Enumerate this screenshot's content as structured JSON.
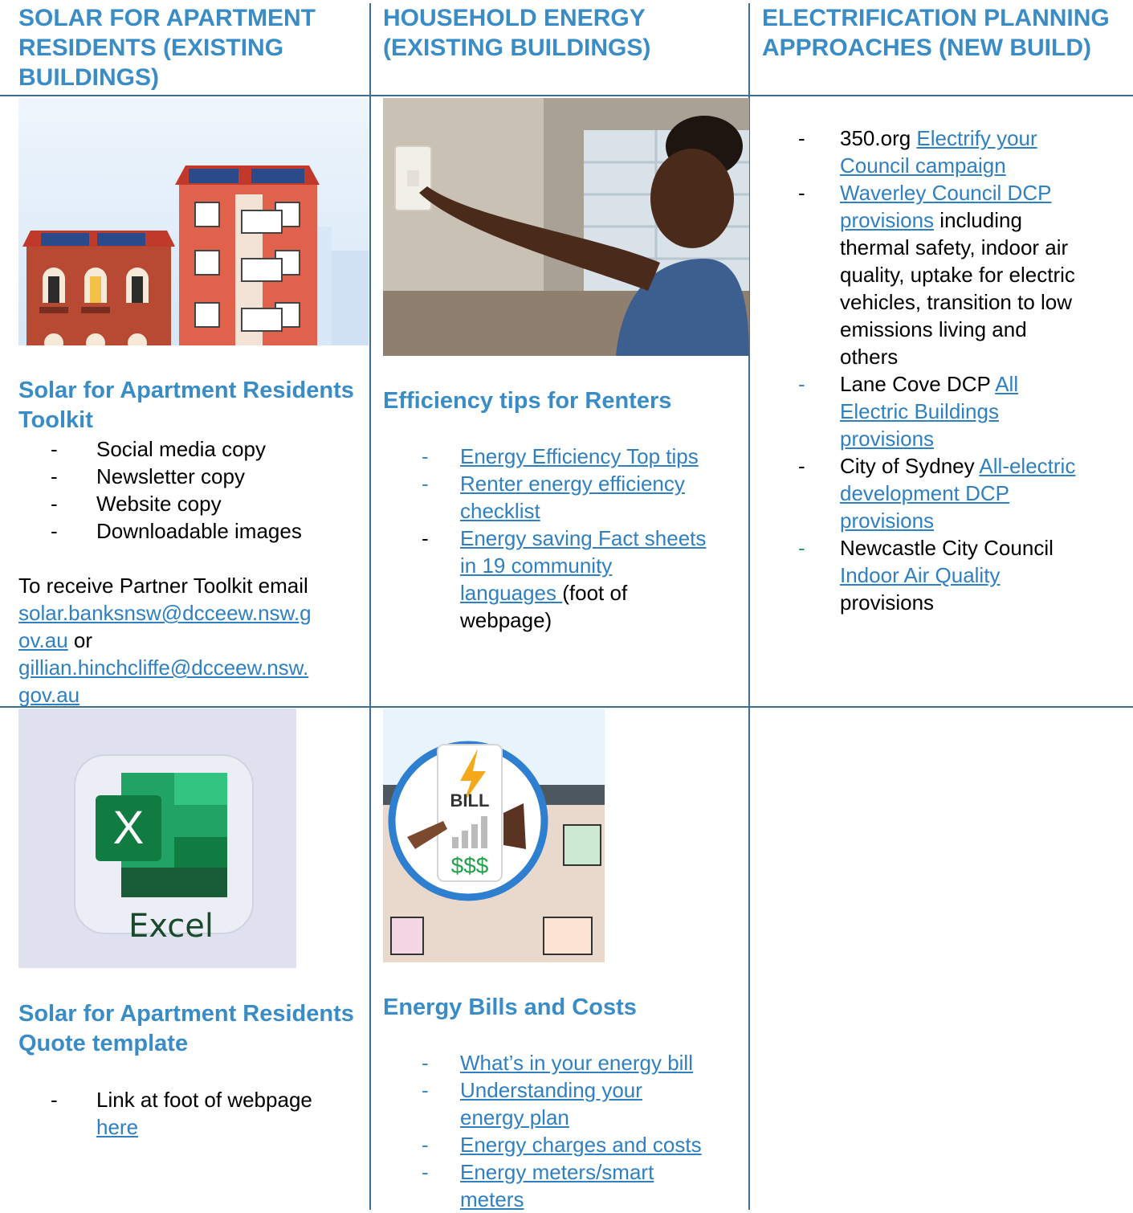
{
  "col1": {
    "heading": "SOLAR FOR APARTMENT RESIDENTS (EXISTING BUILDINGS)",
    "toolkit": {
      "title": "Solar for Apartment Residents Toolkit",
      "items": [
        "Social media copy",
        "Newsletter copy",
        "Website copy",
        "Downloadable images"
      ],
      "email_intro": "To receive Partner Toolkit email",
      "email1_line1": "solar.banksnsw@dcceew.nsw.g",
      "email1_line2": "ov.au",
      "or": " or",
      "email2_line1": "gillian.hinchcliffe@dcceew.nsw.",
      "email2_line2": "gov.au"
    },
    "quote": {
      "excel_label": "Excel",
      "excel_letter": "X",
      "title": "Solar for Apartment Residents Quote template",
      "item_text": "Link at foot of webpage",
      "item_link": "here"
    }
  },
  "col2": {
    "heading": "HOUSEHOLD ENERGY (EXISTING BUILDINGS)",
    "renters": {
      "title": "Efficiency tips for Renters",
      "link1": "Energy Efficiency Top tips",
      "link2_l1": "Renter energy efficiency",
      "link2_l2": "checklist",
      "link3_l1": "Energy saving Fact sheets",
      "link3_l2": "in 19 community",
      "link3_l3": "languages ",
      "link3_after": "(foot of",
      "link3_after2": "webpage)"
    },
    "bills": {
      "bill_label": "BILL",
      "bill_money": "$$$",
      "title": "Energy Bills and Costs",
      "link1": "What’s in your energy bill",
      "link2_l1": "Understanding your",
      "link2_l2": "energy plan",
      "link3": "Energy charges and costs",
      "link4_l1": "Energy meters/smart",
      "link4_l2": "meters"
    }
  },
  "col3": {
    "heading": "ELECTRIFICATION PLANNING APPROACHES (NEW BUILD)",
    "i1_text": "350.org ",
    "i1_link_l1": "Electrify your",
    "i1_link_l2": "Council campaign",
    "i2_link_l1": "Waverley Council DCP",
    "i2_link_l2": "provisions",
    "i2_text_l2": " including",
    "i2_text_rest": [
      "thermal safety, indoor air",
      "quality, uptake for electric",
      "vehicles, transition to low",
      "emissions living and",
      "others"
    ],
    "i3_text": "Lane Cove DCP ",
    "i3_link_l1": "All",
    "i3_link_l2": "Electric Buildings",
    "i3_link_l3": "provisions",
    "i4_text": "City of Sydney ",
    "i4_link_l1": "All-electric",
    "i4_link_l2": "development DCP",
    "i4_link_l3": "provisions",
    "i5_text": "Newcastle City Council",
    "i5_link": "Indoor Air Quality",
    "i5_after": "provisions"
  },
  "bullet": "-",
  "colors": {
    "heading": "#3a8cc7",
    "link": "#2f7fc1",
    "rule": "#3d6f95"
  }
}
